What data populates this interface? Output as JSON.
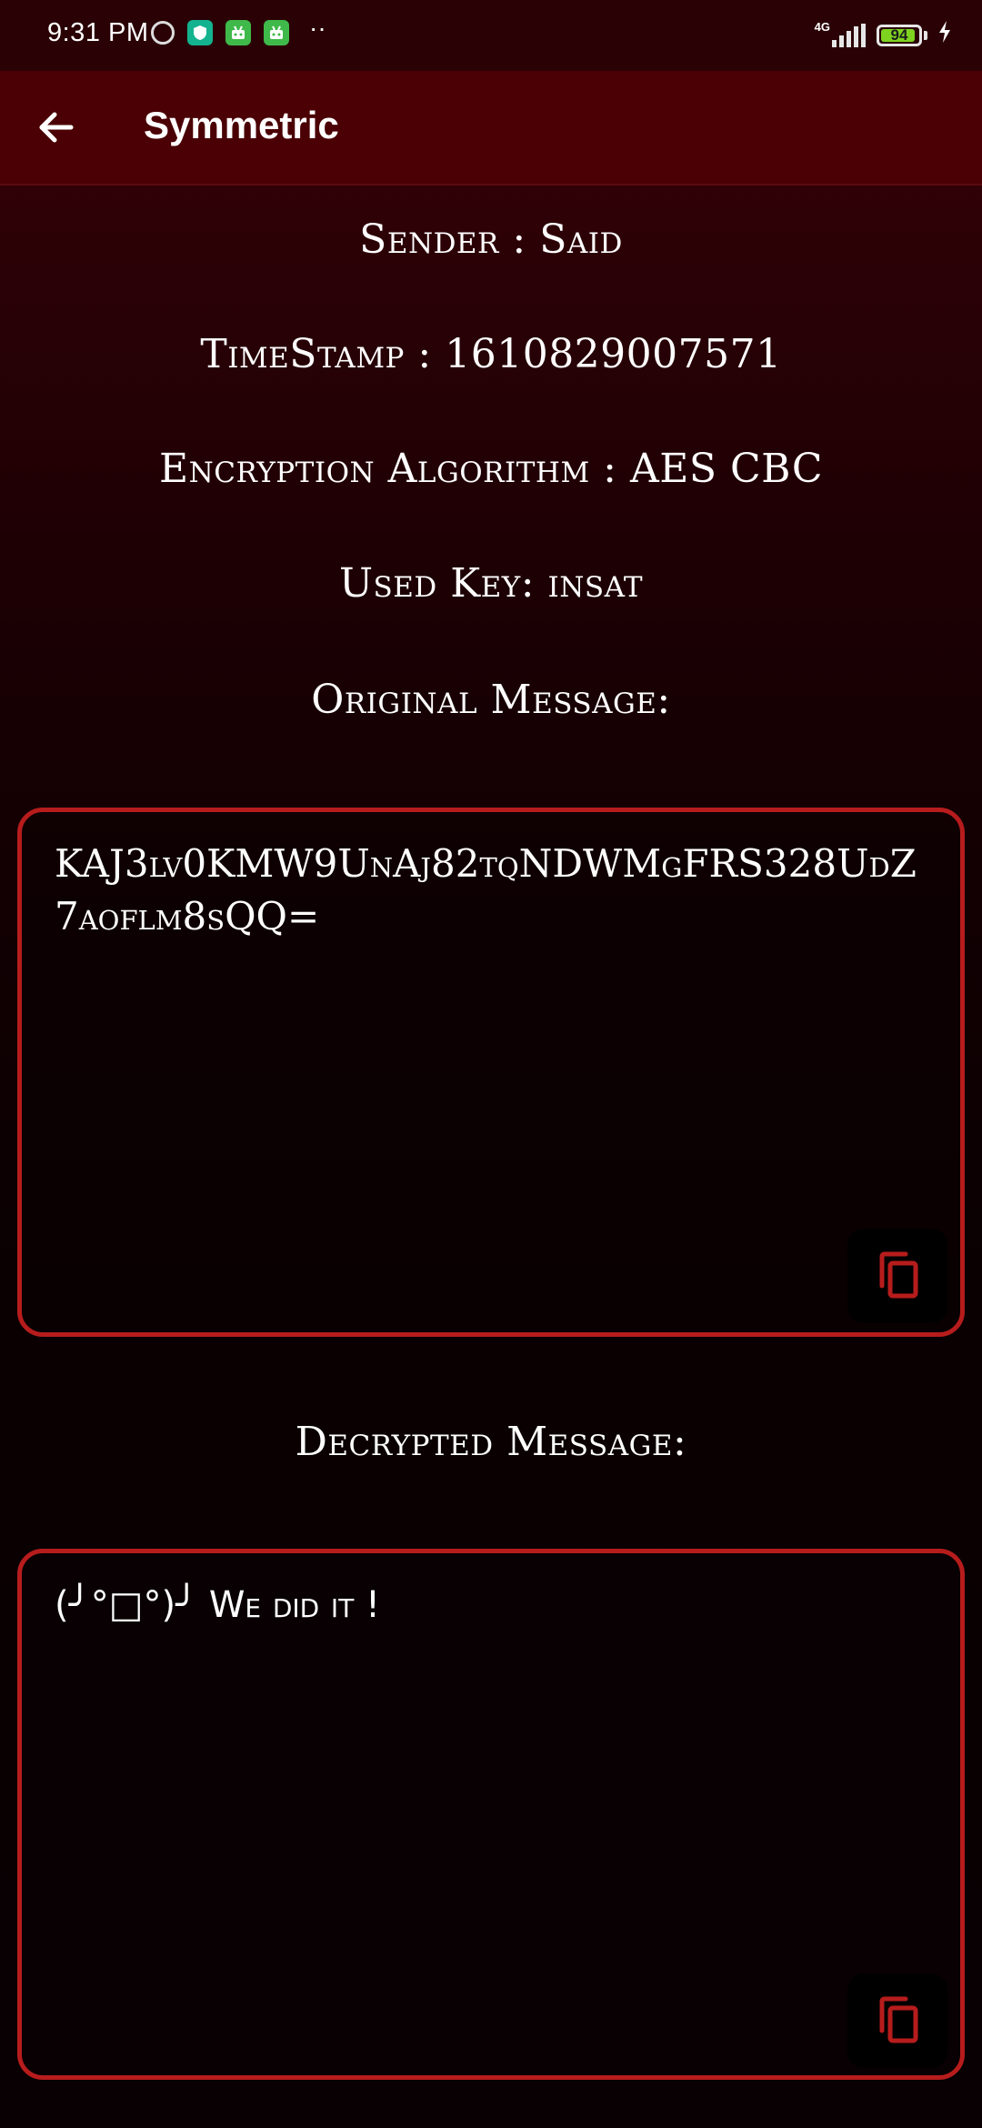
{
  "status_bar": {
    "time": "9:31 PM",
    "network": "4G",
    "battery": "94",
    "battery_level": 0.94,
    "dots": "··"
  },
  "app_bar": {
    "title": "Symmetric",
    "back_icon": "arrow-left-icon"
  },
  "details": {
    "sender": "Sender : Said",
    "timestamp": "TimeStamp : 1610829007571",
    "algorithm": "Encryption Algorithm : AES CBC",
    "used_key": "Used Key: insat",
    "original_label": "Original Message:",
    "decrypted_label": "Decrypted Message:"
  },
  "original_message": {
    "text": "KAJ3lv0KMW9UnAj82tqNDWMgFRS328UdZ7aoflm8sQQ=",
    "copy_icon": "copy-icon"
  },
  "decrypted_message": {
    "text": "(╯°□°)╯ We did it !",
    "copy_icon": "copy-icon"
  },
  "colors": {
    "accent": "#b71c1c",
    "app_bar": "#4a0004",
    "background_top": "#3c0208",
    "background_bottom": "#080002",
    "text": "#ffffff"
  }
}
